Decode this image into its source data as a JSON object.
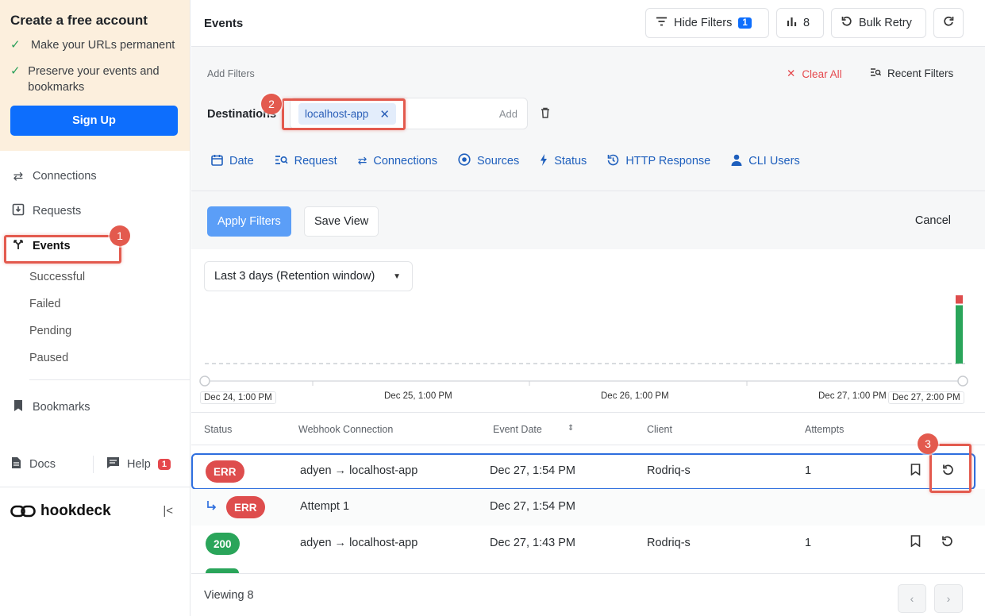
{
  "sidebar": {
    "promo": {
      "title": "Create a free account",
      "items": [
        "Make your URLs permanent",
        "Preserve your events and bookmarks"
      ],
      "signup_label": "Sign Up"
    },
    "nav": {
      "connections": "Connections",
      "requests": "Requests",
      "events": "Events",
      "sub_items": [
        "Successful",
        "Failed",
        "Pending",
        "Paused"
      ],
      "bookmarks": "Bookmarks"
    },
    "docs": "Docs",
    "help": "Help",
    "help_badge": "1",
    "brand": "hookdeck"
  },
  "header": {
    "title": "Events",
    "hide_filters_label": "Hide Filters",
    "hide_filters_badge": "1",
    "metrics_count": "8",
    "bulk_retry_label": "Bulk Retry"
  },
  "filters": {
    "add_filters_label": "Add Filters",
    "clear_all_label": "Clear All",
    "recent_filters_label": "Recent Filters",
    "destinations_label": "Destinations",
    "destination_chip": "localhost-app",
    "add_placeholder": "Add",
    "types": [
      "Date",
      "Request",
      "Connections",
      "Sources",
      "Status",
      "HTTP Response",
      "CLI Users"
    ],
    "apply_label": "Apply Filters",
    "save_view_label": "Save View",
    "cancel_label": "Cancel"
  },
  "date_range": {
    "selected": "Last 3 days (Retention window)"
  },
  "chart_data": {
    "type": "bar",
    "x": [
      "Dec 24, 1:00 PM",
      "Dec 25, 1:00 PM",
      "Dec 26, 1:00 PM",
      "Dec 27, 1:00 PM",
      "Dec 27, 2:00 PM"
    ],
    "series_colors": {
      "success": "#2aa55a",
      "error": "#de4d4d"
    },
    "bars": [
      {
        "x": "Dec 27, 1:54 PM",
        "success": 7,
        "error": 1
      }
    ]
  },
  "table": {
    "headers": [
      "Status",
      "Webhook Connection",
      "Event Date",
      "Client",
      "Attempts"
    ],
    "rows": [
      {
        "status": "ERR",
        "connection": "adyen → localhost-app",
        "date": "Dec 27, 1:54 PM",
        "client": "Rodriq-s",
        "attempts": "1"
      },
      {
        "status": "ERR",
        "connection": "Attempt 1",
        "date": "Dec 27, 1:54 PM",
        "client": "",
        "attempts": ""
      },
      {
        "status": "200",
        "connection": "adyen → localhost-app",
        "date": "Dec 27, 1:43 PM",
        "client": "Rodriq-s",
        "attempts": "1"
      }
    ]
  },
  "footer": {
    "viewing": "Viewing 8"
  },
  "annotations": [
    "1",
    "2",
    "3"
  ],
  "colors": {
    "accent": "#0d6efd",
    "error": "#de4d4d",
    "success": "#2aa55a",
    "annotation": "#e35a4e"
  }
}
